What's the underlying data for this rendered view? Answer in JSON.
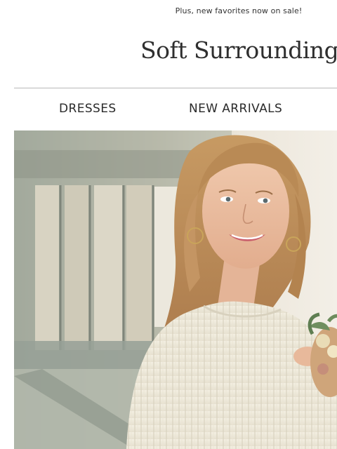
{
  "promo": {
    "text": "Plus, new favorites now on sale!"
  },
  "brand": {
    "logo_text": "Soft Surroundings"
  },
  "nav": {
    "items": [
      {
        "label": "DRESSES"
      },
      {
        "label": "NEW ARRIVALS"
      }
    ]
  },
  "hero": {
    "image": "hero-photo"
  }
}
